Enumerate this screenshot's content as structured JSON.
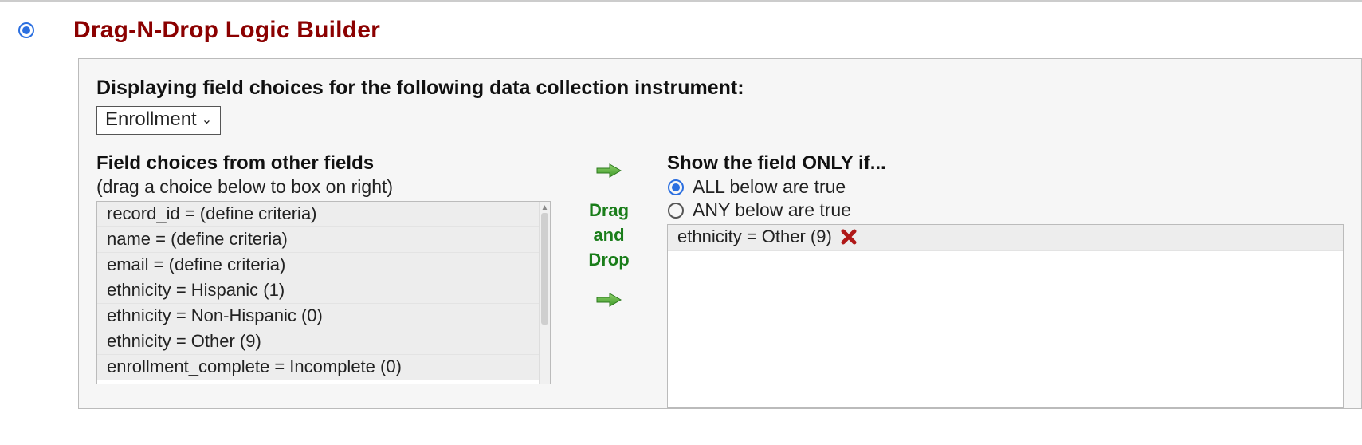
{
  "header": {
    "title": "Drag-N-Drop Logic Builder"
  },
  "instrument": {
    "label": "Displaying field choices for the following data collection instrument:",
    "selected": "Enrollment"
  },
  "left": {
    "heading": "Field choices from other fields",
    "sub": "(drag a choice below to box on right)",
    "choices": [
      "record_id = (define criteria)",
      "name = (define criteria)",
      "email = (define criteria)",
      "ethnicity = Hispanic (1)",
      "ethnicity = Non-Hispanic (0)",
      "ethnicity = Other (9)",
      "enrollment_complete = Incomplete (0)"
    ]
  },
  "mid": {
    "line1": "Drag",
    "line2": "and",
    "line3": "Drop"
  },
  "right": {
    "heading": "Show the field ONLY if...",
    "opt_all": "ALL below are true",
    "opt_any": "ANY below are true",
    "selected": "all",
    "dropped": [
      "ethnicity = Other (9)"
    ]
  }
}
